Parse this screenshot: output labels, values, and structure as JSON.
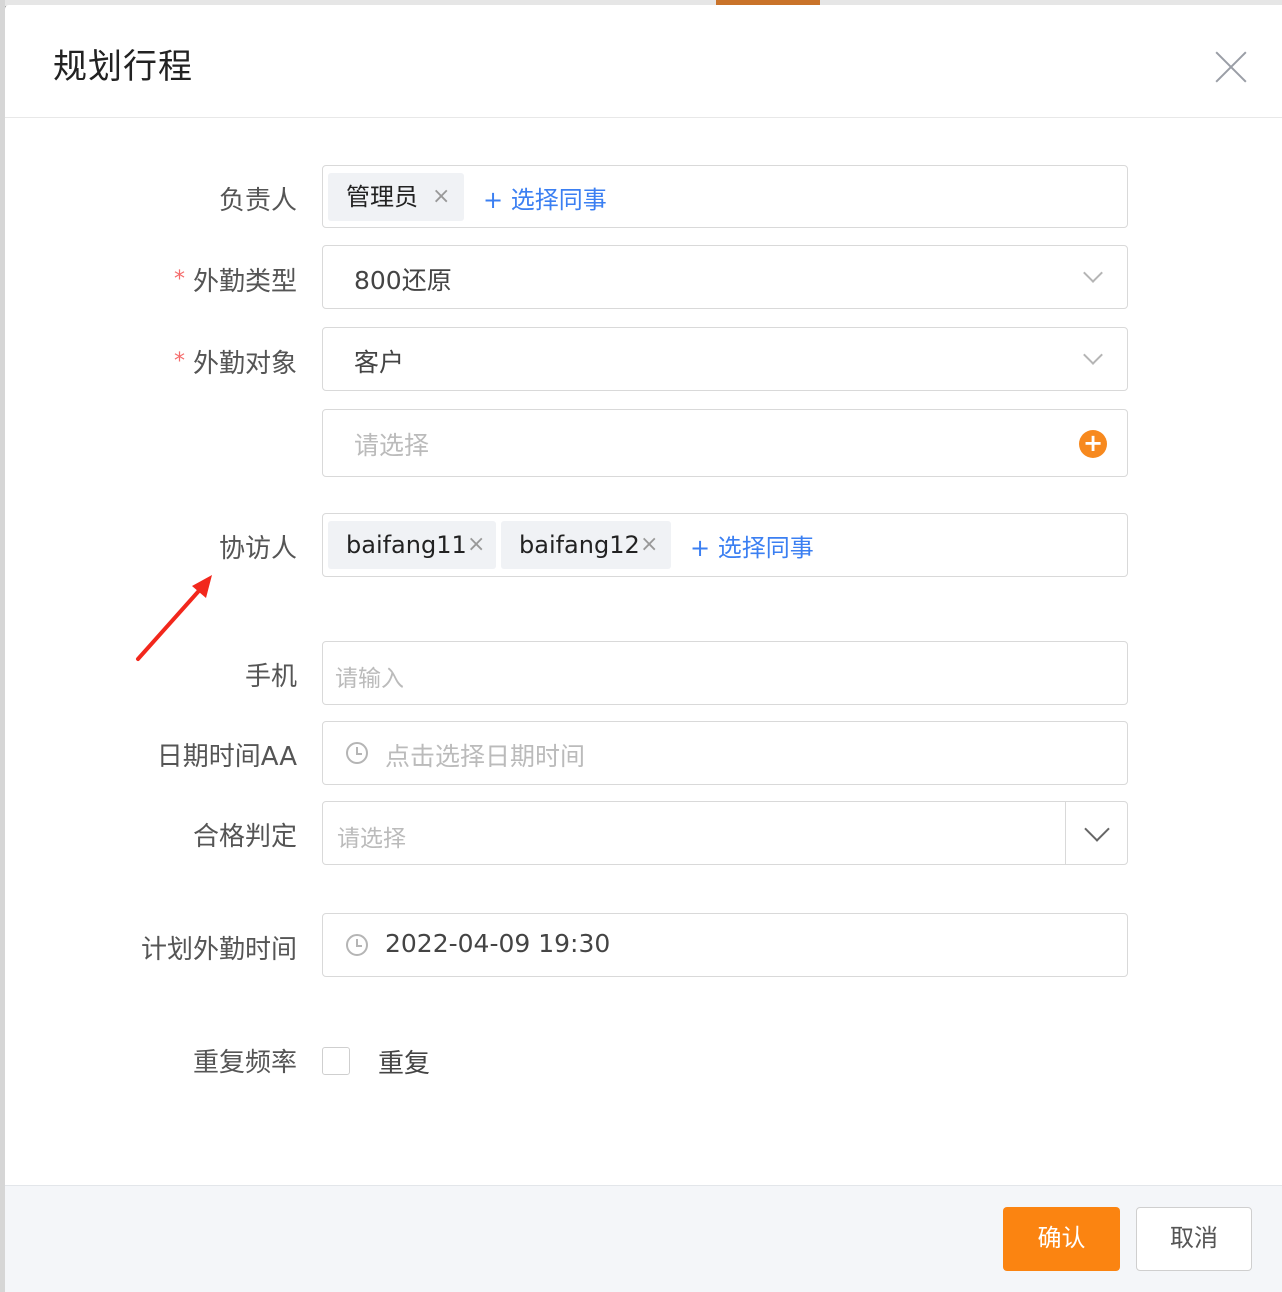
{
  "dialog": {
    "title": "规划行程"
  },
  "form": {
    "owner": {
      "label": "负责人",
      "tags": [
        "管理员"
      ],
      "add_link": "+ 选择同事"
    },
    "visit_type": {
      "required_mark": "*",
      "label": "外勤类型",
      "value": "800还原"
    },
    "visit_target": {
      "required_mark": "*",
      "label": "外勤对象",
      "value": "客户"
    },
    "target_picker": {
      "placeholder": "请选择",
      "add_icon": "+"
    },
    "co_visitors": {
      "label": "协访人",
      "tags": [
        "baifang11",
        "baifang12"
      ],
      "add_link": "+ 选择同事"
    },
    "phone": {
      "label": "手机",
      "placeholder": "请输入"
    },
    "datetime_aa": {
      "label": "日期时间AA",
      "placeholder": "点击选择日期时间"
    },
    "qualification": {
      "label": "合格判定",
      "placeholder": "请选择"
    },
    "planned_time": {
      "label": "计划外勤时间",
      "value": "2022-04-09 19:30"
    },
    "repeat": {
      "label": "重复频率",
      "checkbox_label": "重复",
      "checked": false
    }
  },
  "footer": {
    "confirm_label": "确认",
    "cancel_label": "取消"
  },
  "colors": {
    "accent": "#fb8411",
    "link": "#3b7ff2",
    "required": "#f56c6c",
    "annotation_arrow": "#f2271c"
  },
  "tag_remove_glyph": "×"
}
